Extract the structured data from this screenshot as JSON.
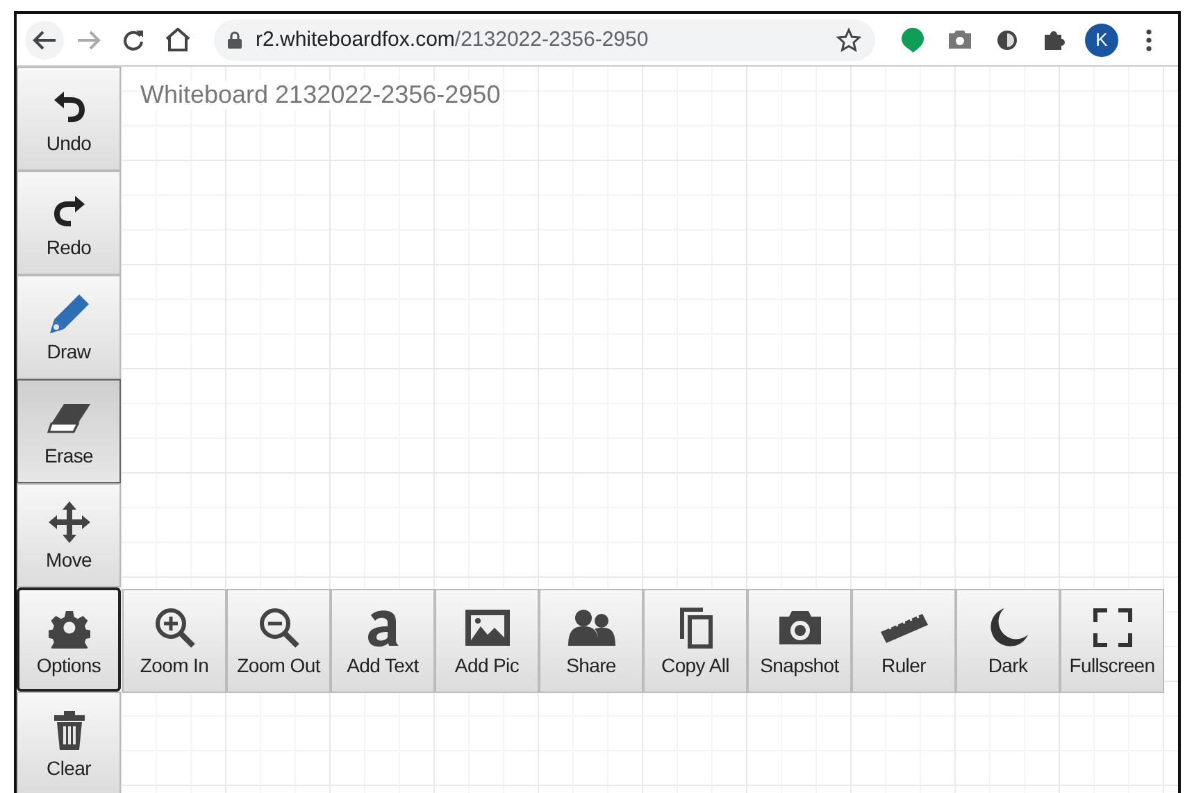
{
  "browser": {
    "url_host": "r2.whiteboardfox.com",
    "url_path": "/2132022-2356-2950",
    "profile_initial": "K"
  },
  "board": {
    "title": "Whiteboard 2132022-2356-2950"
  },
  "sidebar": {
    "items": [
      {
        "kind": "undo",
        "label": "Undo",
        "selected": false,
        "expanded": false
      },
      {
        "kind": "redo",
        "label": "Redo",
        "selected": false,
        "expanded": false
      },
      {
        "kind": "draw",
        "label": "Draw",
        "selected": false,
        "expanded": false
      },
      {
        "kind": "erase",
        "label": "Erase",
        "selected": true,
        "expanded": false
      },
      {
        "kind": "move",
        "label": "Move",
        "selected": false,
        "expanded": false
      },
      {
        "kind": "options",
        "label": "Options",
        "selected": false,
        "expanded": true
      },
      {
        "kind": "clear",
        "label": "Clear",
        "selected": false,
        "expanded": false
      }
    ]
  },
  "options_toolbar": {
    "items": [
      {
        "kind": "zoomin",
        "label": "Zoom In"
      },
      {
        "kind": "zoomout",
        "label": "Zoom Out"
      },
      {
        "kind": "text",
        "label": "Add Text"
      },
      {
        "kind": "pic",
        "label": "Add Pic"
      },
      {
        "kind": "share",
        "label": "Share"
      },
      {
        "kind": "copy",
        "label": "Copy All"
      },
      {
        "kind": "snapshot",
        "label": "Snapshot"
      },
      {
        "kind": "ruler",
        "label": "Ruler"
      },
      {
        "kind": "dark",
        "label": "Dark"
      },
      {
        "kind": "fullscreen",
        "label": "Fullscreen"
      }
    ]
  }
}
